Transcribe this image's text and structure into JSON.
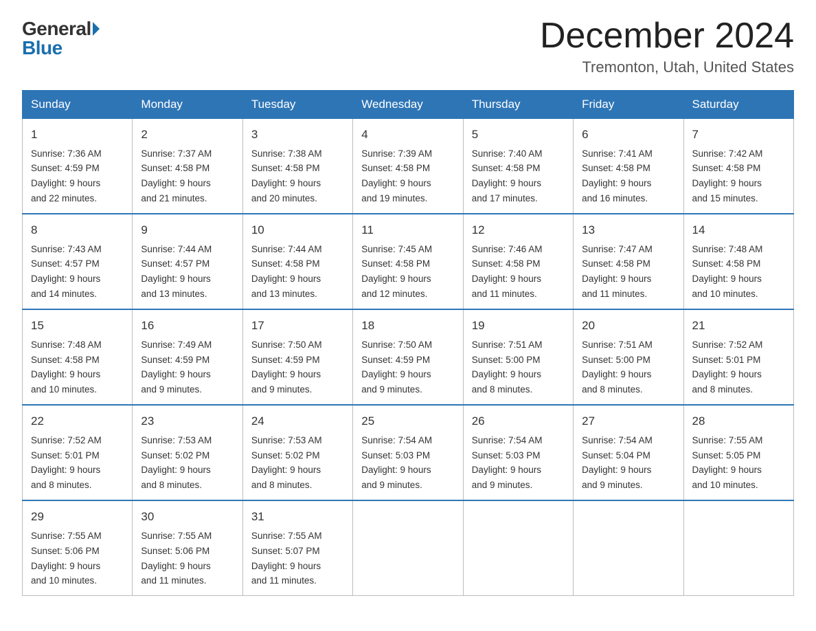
{
  "header": {
    "logo": {
      "general": "General",
      "blue": "Blue"
    },
    "title": "December 2024",
    "location": "Tremonton, Utah, United States"
  },
  "weekdays": [
    "Sunday",
    "Monday",
    "Tuesday",
    "Wednesday",
    "Thursday",
    "Friday",
    "Saturday"
  ],
  "weeks": [
    [
      {
        "day": "1",
        "sunrise": "7:36 AM",
        "sunset": "4:59 PM",
        "daylight": "9 hours and 22 minutes."
      },
      {
        "day": "2",
        "sunrise": "7:37 AM",
        "sunset": "4:58 PM",
        "daylight": "9 hours and 21 minutes."
      },
      {
        "day": "3",
        "sunrise": "7:38 AM",
        "sunset": "4:58 PM",
        "daylight": "9 hours and 20 minutes."
      },
      {
        "day": "4",
        "sunrise": "7:39 AM",
        "sunset": "4:58 PM",
        "daylight": "9 hours and 19 minutes."
      },
      {
        "day": "5",
        "sunrise": "7:40 AM",
        "sunset": "4:58 PM",
        "daylight": "9 hours and 17 minutes."
      },
      {
        "day": "6",
        "sunrise": "7:41 AM",
        "sunset": "4:58 PM",
        "daylight": "9 hours and 16 minutes."
      },
      {
        "day": "7",
        "sunrise": "7:42 AM",
        "sunset": "4:58 PM",
        "daylight": "9 hours and 15 minutes."
      }
    ],
    [
      {
        "day": "8",
        "sunrise": "7:43 AM",
        "sunset": "4:57 PM",
        "daylight": "9 hours and 14 minutes."
      },
      {
        "day": "9",
        "sunrise": "7:44 AM",
        "sunset": "4:57 PM",
        "daylight": "9 hours and 13 minutes."
      },
      {
        "day": "10",
        "sunrise": "7:44 AM",
        "sunset": "4:58 PM",
        "daylight": "9 hours and 13 minutes."
      },
      {
        "day": "11",
        "sunrise": "7:45 AM",
        "sunset": "4:58 PM",
        "daylight": "9 hours and 12 minutes."
      },
      {
        "day": "12",
        "sunrise": "7:46 AM",
        "sunset": "4:58 PM",
        "daylight": "9 hours and 11 minutes."
      },
      {
        "day": "13",
        "sunrise": "7:47 AM",
        "sunset": "4:58 PM",
        "daylight": "9 hours and 11 minutes."
      },
      {
        "day": "14",
        "sunrise": "7:48 AM",
        "sunset": "4:58 PM",
        "daylight": "9 hours and 10 minutes."
      }
    ],
    [
      {
        "day": "15",
        "sunrise": "7:48 AM",
        "sunset": "4:58 PM",
        "daylight": "9 hours and 10 minutes."
      },
      {
        "day": "16",
        "sunrise": "7:49 AM",
        "sunset": "4:59 PM",
        "daylight": "9 hours and 9 minutes."
      },
      {
        "day": "17",
        "sunrise": "7:50 AM",
        "sunset": "4:59 PM",
        "daylight": "9 hours and 9 minutes."
      },
      {
        "day": "18",
        "sunrise": "7:50 AM",
        "sunset": "4:59 PM",
        "daylight": "9 hours and 9 minutes."
      },
      {
        "day": "19",
        "sunrise": "7:51 AM",
        "sunset": "5:00 PM",
        "daylight": "9 hours and 8 minutes."
      },
      {
        "day": "20",
        "sunrise": "7:51 AM",
        "sunset": "5:00 PM",
        "daylight": "9 hours and 8 minutes."
      },
      {
        "day": "21",
        "sunrise": "7:52 AM",
        "sunset": "5:01 PM",
        "daylight": "9 hours and 8 minutes."
      }
    ],
    [
      {
        "day": "22",
        "sunrise": "7:52 AM",
        "sunset": "5:01 PM",
        "daylight": "9 hours and 8 minutes."
      },
      {
        "day": "23",
        "sunrise": "7:53 AM",
        "sunset": "5:02 PM",
        "daylight": "9 hours and 8 minutes."
      },
      {
        "day": "24",
        "sunrise": "7:53 AM",
        "sunset": "5:02 PM",
        "daylight": "9 hours and 8 minutes."
      },
      {
        "day": "25",
        "sunrise": "7:54 AM",
        "sunset": "5:03 PM",
        "daylight": "9 hours and 9 minutes."
      },
      {
        "day": "26",
        "sunrise": "7:54 AM",
        "sunset": "5:03 PM",
        "daylight": "9 hours and 9 minutes."
      },
      {
        "day": "27",
        "sunrise": "7:54 AM",
        "sunset": "5:04 PM",
        "daylight": "9 hours and 9 minutes."
      },
      {
        "day": "28",
        "sunrise": "7:55 AM",
        "sunset": "5:05 PM",
        "daylight": "9 hours and 10 minutes."
      }
    ],
    [
      {
        "day": "29",
        "sunrise": "7:55 AM",
        "sunset": "5:06 PM",
        "daylight": "9 hours and 10 minutes."
      },
      {
        "day": "30",
        "sunrise": "7:55 AM",
        "sunset": "5:06 PM",
        "daylight": "9 hours and 11 minutes."
      },
      {
        "day": "31",
        "sunrise": "7:55 AM",
        "sunset": "5:07 PM",
        "daylight": "9 hours and 11 minutes."
      },
      null,
      null,
      null,
      null
    ]
  ],
  "labels": {
    "sunrise": "Sunrise:",
    "sunset": "Sunset:",
    "daylight": "Daylight:"
  }
}
